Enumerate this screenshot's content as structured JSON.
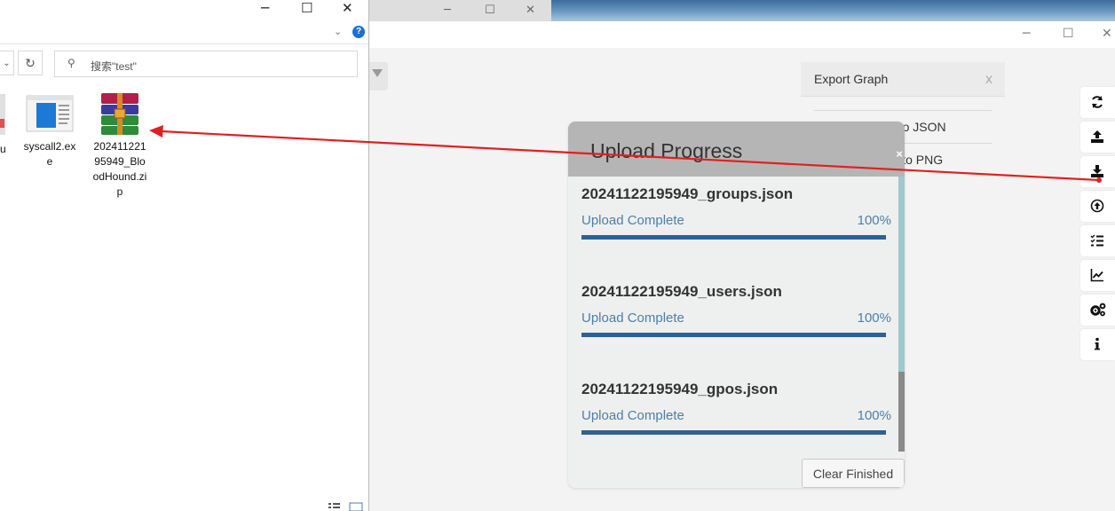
{
  "explorer": {
    "window_controls": {
      "minimize": "─",
      "maximize": "☐",
      "close": "✕"
    },
    "ribbon_chevron": "⌄",
    "help": "?",
    "address_dropdown": "⌄",
    "refresh": "↻",
    "search_placeholder": "搜索\"test\"",
    "partial_file_label": "u",
    "files": [
      {
        "label": "syscall2.exe",
        "icon": "exe-window-icon"
      },
      {
        "label": "20241122195949_BloodHound.zip",
        "icon": "winrar-archive-icon"
      }
    ]
  },
  "background_window": {
    "controls": {
      "minimize": "─",
      "maximize": "☐",
      "close": "✕"
    }
  },
  "app": {
    "window_controls": {
      "minimize": "─",
      "maximize": "☐",
      "close": "✕"
    },
    "export_panel": {
      "title": "Export Graph",
      "close": "x",
      "items": [
        "Export to JSON",
        "Export to PNG"
      ]
    },
    "upload_modal": {
      "title": "Upload Progress",
      "close": "×",
      "items": [
        {
          "file": "20241122195949_groups.json",
          "status": "Upload Complete",
          "percent": "100%",
          "progress": 1.0
        },
        {
          "file": "20241122195949_users.json",
          "status": "Upload Complete",
          "percent": "100%",
          "progress": 1.0
        },
        {
          "file": "20241122195949_gpos.json",
          "status": "Upload Complete",
          "percent": "100%",
          "progress": 1.0
        }
      ],
      "clear_button": "Clear Finished"
    },
    "toolbar": [
      {
        "name": "refresh-icon"
      },
      {
        "name": "export-icon"
      },
      {
        "name": "import-icon"
      },
      {
        "name": "upload-data-icon"
      },
      {
        "name": "queries-list-icon"
      },
      {
        "name": "database-info-icon"
      },
      {
        "name": "settings-icon"
      },
      {
        "name": "about-icon"
      }
    ],
    "colors": {
      "arrow": "#e02020",
      "progress_fill": "#2e6193",
      "status_text": "#4f7ea6",
      "modal_header": "#b5b5b5"
    }
  }
}
